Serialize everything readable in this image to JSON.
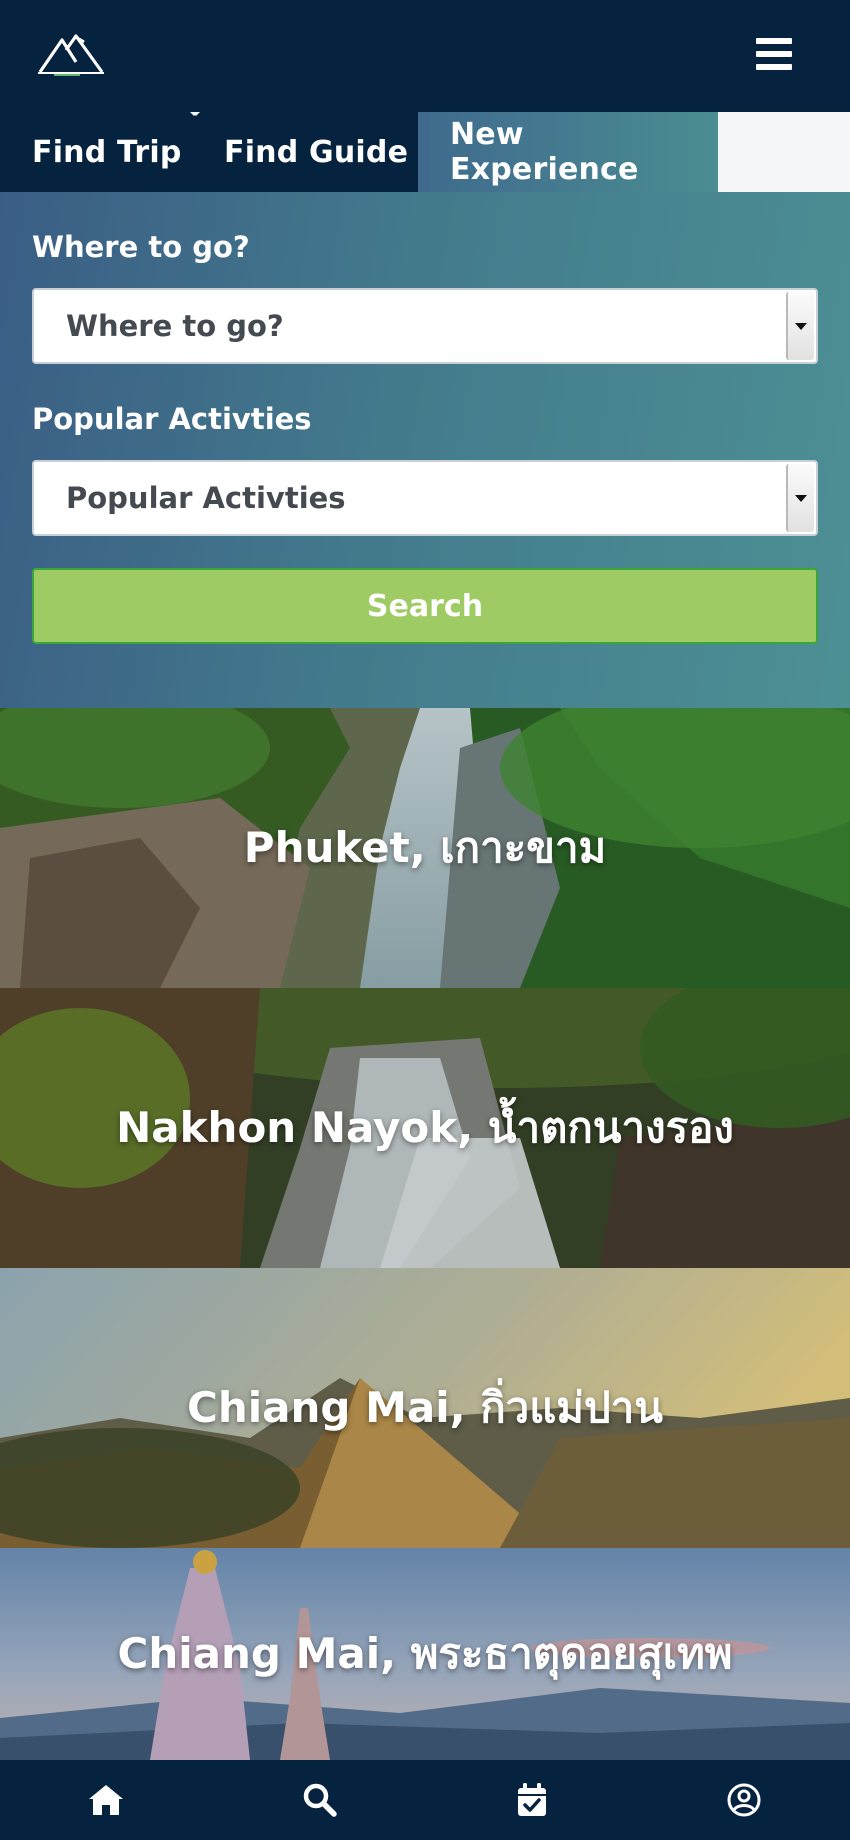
{
  "header": {
    "logo_icon": "mountain-logo",
    "menu_icon": "hamburger-menu-icon"
  },
  "tabs": [
    {
      "label": "Find Trip",
      "active": false
    },
    {
      "label": "Find Guide",
      "active": false
    },
    {
      "label": "New Experience",
      "active": true
    }
  ],
  "search": {
    "where_label": "Where to go?",
    "where_value": "Where to go?",
    "activities_label": "Popular Activties",
    "activities_value": "Popular Activties",
    "button_label": "Search",
    "button_color": "#9fcb65"
  },
  "destinations": [
    {
      "title": "Phuket, เกาะขาม"
    },
    {
      "title": "Nakhon Nayok, น้ำตกนางรอง"
    },
    {
      "title": "Chiang Mai, กิ่วแม่ปาน"
    },
    {
      "title": "Chiang Mai, พระธาตุดอยสุเทพ"
    }
  ],
  "bottom_nav": [
    {
      "icon": "home-icon"
    },
    {
      "icon": "search-icon"
    },
    {
      "icon": "calendar-check-icon"
    },
    {
      "icon": "user-circle-icon"
    }
  ],
  "colors": {
    "header_bg": "#05223f",
    "accent_green": "#9fcb65",
    "panel_teal": "#4b8d91"
  }
}
